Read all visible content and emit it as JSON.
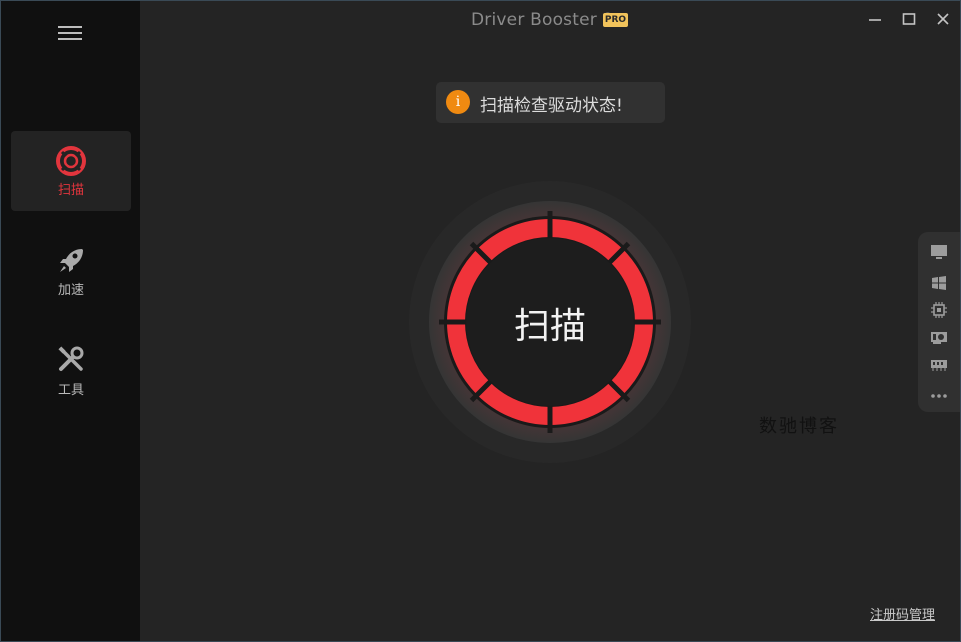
{
  "app": {
    "title": "Driver Booster 9",
    "badge": "PRO"
  },
  "sidebar": {
    "items": [
      {
        "label": "扫描",
        "icon": "lifebuoy-icon",
        "active": true
      },
      {
        "label": "加速",
        "icon": "rocket-icon",
        "active": false
      },
      {
        "label": "工具",
        "icon": "tools-icon",
        "active": false
      }
    ]
  },
  "notice": {
    "text": "扫描检查驱动状态!",
    "icon": "info-icon"
  },
  "scan": {
    "label": "扫描"
  },
  "hardware_bar": {
    "icons": [
      "monitor-icon",
      "windows-icon",
      "cpu-icon",
      "graphics-card-icon",
      "memory-icon",
      "more-icon"
    ]
  },
  "watermark": {
    "text": "数驰博客"
  },
  "footer": {
    "register_link": "注册码管理"
  },
  "colors": {
    "accent": "#e2353d",
    "ring": "#f0333a",
    "info": "#f08a11",
    "badge": "#f1c35b"
  }
}
